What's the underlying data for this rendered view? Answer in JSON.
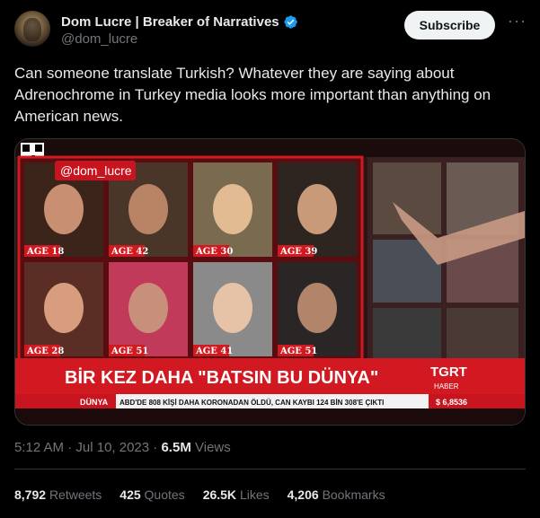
{
  "author": {
    "name": "Dom Lucre | Breaker of Narratives",
    "handle": "@dom_lucre",
    "verified_color": "#1d9bf0"
  },
  "header": {
    "subscribe_label": "Subscribe",
    "more_label": "···"
  },
  "tweet": {
    "text": "Can someone translate Turkish? Whatever they are saying about Adrenochrome in Turkey media looks more important than anything on American news."
  },
  "media": {
    "watermark": "@dom_lucre",
    "age_labels": [
      "AGE 18",
      "AGE 42",
      "AGE 30",
      "AGE 39",
      "AGE 28",
      "AGE 51",
      "AGE 41",
      "AGE 51"
    ],
    "headline": "BİR KEZ DAHA \"BATSIN BU DÜNYA\"",
    "channel": "TGRT",
    "channel_sub": "HABER",
    "ticker_section": "DÜNYA",
    "ticker_text": "ABD'DE 808 KİŞİ DAHA KORONADAN ÖLDÜ, CAN KAYBI 124 BİN 308'E ÇIKTI",
    "ticker_value": "$ 6,8536",
    "colors": {
      "red": "#c8141e",
      "dark_red": "#7a0c10",
      "ticker_bg": "#f2f2f2"
    }
  },
  "meta": {
    "time": "5:12 AM",
    "separator": "·",
    "date": "Jul 10, 2023",
    "views_count": "6.5M",
    "views_label": "Views"
  },
  "stats": {
    "retweets_count": "8,792",
    "retweets_label": "Retweets",
    "quotes_count": "425",
    "quotes_label": "Quotes",
    "likes_count": "26.5K",
    "likes_label": "Likes",
    "bookmarks_count": "4,206",
    "bookmarks_label": "Bookmarks"
  }
}
